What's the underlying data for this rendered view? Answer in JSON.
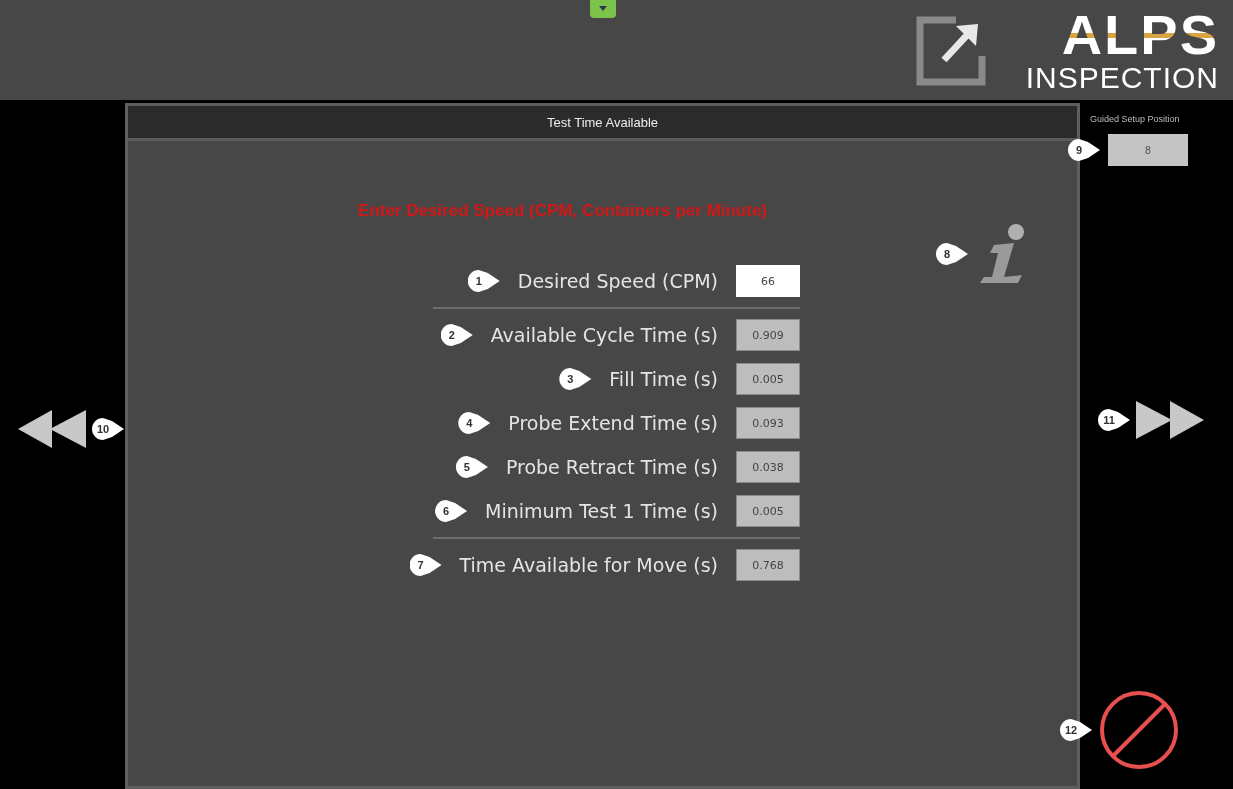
{
  "header": {
    "logo_title": "ALPS",
    "logo_subtitle": "INSPECTION"
  },
  "panel": {
    "title": "Test Time Available",
    "instruction": "Enter Desired Speed (CPM, Containers per Minute)",
    "info_callout": "8",
    "groups": [
      [
        {
          "callout": "1",
          "label": "Desired Speed (CPM)",
          "value": "66",
          "kind": "input"
        }
      ],
      [
        {
          "callout": "2",
          "label": "Available Cycle Time (s)",
          "value": "0.909",
          "kind": "readout"
        },
        {
          "callout": "3",
          "label": "Fill Time (s)",
          "value": "0.005",
          "kind": "readout"
        },
        {
          "callout": "4",
          "label": "Probe Extend Time (s)",
          "value": "0.093",
          "kind": "readout"
        },
        {
          "callout": "5",
          "label": "Probe Retract Time (s)",
          "value": "0.038",
          "kind": "readout"
        },
        {
          "callout": "6",
          "label": "Minimum Test 1 Time (s)",
          "value": "0.005",
          "kind": "readout"
        }
      ],
      [
        {
          "callout": "7",
          "label": "Time Available for Move (s)",
          "value": "0.768",
          "kind": "readout"
        }
      ]
    ]
  },
  "side": {
    "position_label": "Guided Setup Position",
    "position_callout": "9",
    "position_value": "8",
    "back_callout": "10",
    "next_callout": "11",
    "cancel_callout": "12"
  }
}
